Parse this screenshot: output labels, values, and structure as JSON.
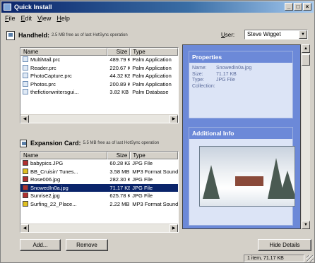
{
  "window": {
    "title": "Quick Install",
    "min": "_",
    "max": "□",
    "close": "×"
  },
  "menu": [
    "File",
    "Edit",
    "View",
    "Help"
  ],
  "handheld": {
    "label": "Handheld:",
    "sub": "2.5 MB free as of last HotSync operation",
    "columns": [
      "Name",
      "Size",
      "Type"
    ],
    "rows": [
      {
        "name": "MultiMail.prc",
        "size": "489.79 KB",
        "type": "Palm Application",
        "icon": "prc"
      },
      {
        "name": "Reader.prc",
        "size": "220.67 KB",
        "type": "Palm Application",
        "icon": "prc"
      },
      {
        "name": "PhotoCapture.prc",
        "size": "44.32 KB",
        "type": "Palm Application",
        "icon": "prc"
      },
      {
        "name": "Photos.prc",
        "size": "200.89 KB",
        "type": "Palm Application",
        "icon": "prc"
      },
      {
        "name": "thefictionwritersgui...",
        "size": "3.82 KB",
        "type": "Palm Database",
        "icon": "pdb"
      }
    ]
  },
  "user": {
    "label": "User:",
    "value": "Steve Wigget"
  },
  "expansion": {
    "label": "Expansion Card:",
    "sub": "5.5 MB free as of last HotSync operation",
    "columns": [
      "Name",
      "Size",
      "Type"
    ],
    "rows": [
      {
        "name": "babypics.JPG",
        "size": "60.28 KB",
        "type": "JPG File",
        "icon": "jpg"
      },
      {
        "name": "BB_Cruisin' Tunes...",
        "size": "3.58 MB",
        "type": "MP3 Format Sound",
        "icon": "mp3"
      },
      {
        "name": "Rose006.jpg",
        "size": "282.30 KB",
        "type": "JPG File",
        "icon": "jpg"
      },
      {
        "name": "SnowedIn0a.jpg",
        "size": "71.17 KB",
        "type": "JPG File",
        "icon": "jpg",
        "selected": true
      },
      {
        "name": "Sunrise2.jpg",
        "size": "625.78 KB",
        "type": "JPG File",
        "icon": "jpg"
      },
      {
        "name": "Surfing_22_Place...",
        "size": "2.22 MB",
        "type": "MP3 Format Sound",
        "icon": "mp3"
      }
    ]
  },
  "properties": {
    "title": "Properties",
    "fields": [
      {
        "k": "Name:",
        "v": "SnowedIn0a.jpg"
      },
      {
        "k": "Size:",
        "v": "71.17 KB"
      },
      {
        "k": "Type:",
        "v": "JPG File"
      },
      {
        "k": "Collection:",
        "v": ""
      }
    ]
  },
  "info": {
    "title": "Additional Info"
  },
  "buttons": {
    "add": "Add...",
    "remove": "Remove",
    "hide": "Hide Details"
  },
  "status": "1 item, 71.17 KB"
}
